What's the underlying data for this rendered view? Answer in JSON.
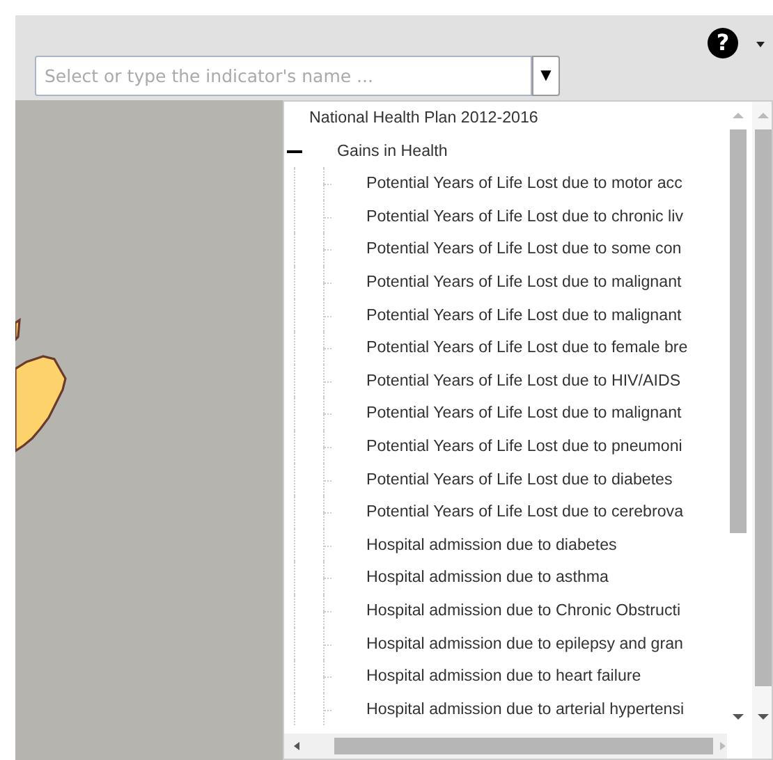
{
  "help_menu": {
    "glyph": "?"
  },
  "search": {
    "placeholder": "Select or type the indicator's name ...",
    "button": "▼"
  },
  "tree": [
    {
      "label": "National Health Plan 2012-2016",
      "children": [
        {
          "label": "Gains in Health",
          "expanded": true,
          "children": [
            {
              "label": "Potential Years of Life Lost due to motor acc"
            },
            {
              "label": "Potential Years of Life Lost due to chronic liv"
            },
            {
              "label": "Potential Years of Life Lost due to some con"
            },
            {
              "label": "Potential Years of Life Lost due to malignant"
            },
            {
              "label": "Potential Years of Life Lost due to malignant"
            },
            {
              "label": "Potential Years of Life Lost due to female bre"
            },
            {
              "label": "Potential Years of Life Lost due to HIV/AIDS"
            },
            {
              "label": "Potential Years of Life Lost due to malignant"
            },
            {
              "label": "Potential Years of Life Lost due to pneumoni"
            },
            {
              "label": "Potential Years of Life Lost due to diabetes"
            },
            {
              "label": "Potential Years of Life Lost due to cerebrova"
            },
            {
              "label": "Hospital admission due to diabetes"
            },
            {
              "label": "Hospital admission due to asthma"
            },
            {
              "label": "Hospital admission due to Chronic Obstructi"
            },
            {
              "label": "Hospital admission due to epilepsy and gran"
            },
            {
              "label": "Hospital admission due to heart failure"
            },
            {
              "label": "Hospital admission due to arterial hypertensi"
            }
          ]
        }
      ]
    }
  ]
}
